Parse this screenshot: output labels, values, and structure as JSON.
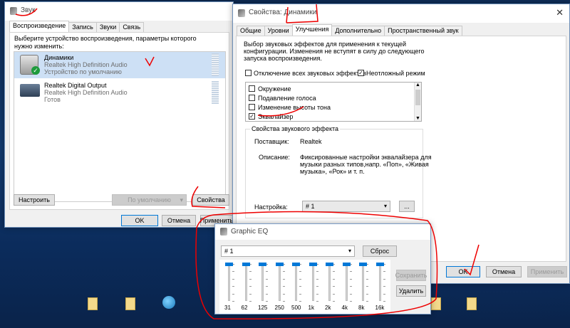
{
  "sound_window": {
    "title": "Звук",
    "tabs": [
      "Воспроизведение",
      "Запись",
      "Звуки",
      "Связь"
    ],
    "instruction": "Выберите устройство воспроизведения, параметры которого нужно изменить:",
    "devices": [
      {
        "name": "Динамики",
        "driver": "Realtek High Definition Audio",
        "status": "Устройство по умолчанию",
        "icon": "speaker-icon"
      },
      {
        "name": "Realtek Digital Output",
        "driver": "Realtek High Definition Audio",
        "status": "Готов",
        "icon": "digital-output-icon"
      }
    ],
    "configure_label": "Настроить",
    "default_label": "По умолчанию",
    "properties_label": "Свойства",
    "ok_label": "OK",
    "cancel_label": "Отмена",
    "apply_label": "Применить"
  },
  "props_window": {
    "title": "Свойства: Динамики",
    "tabs": [
      "Общие",
      "Уровни",
      "Улучшения",
      "Дополнительно",
      "Пространственный звук"
    ],
    "description": [
      "Выбор звуковых эффектов для применения к текущей",
      "конфигурации. Изменения не вступят в силу до следующего",
      "запуска воспроизведения."
    ],
    "disable_all_label": "Отключение всех звуковых эффектов",
    "immediate_label": "Неотложный режим",
    "effects": [
      {
        "label": "Окружение",
        "checked": false
      },
      {
        "label": "Подавление голоса",
        "checked": false
      },
      {
        "label": "Изменение высоты тона",
        "checked": false
      },
      {
        "label": "Эквалайзер",
        "checked": true
      }
    ],
    "group_title": "Свойства звукового эффекта",
    "provider_label": "Поставщик:",
    "provider_value": "Realtek",
    "desc_label": "Описание:",
    "desc_value": [
      "Фиксированные настройки эквалайзера для",
      "музыки разных типов,напр. «Поп», «Живая",
      "музыка», «Рок» и т. п."
    ],
    "setting_label": "Настройка:",
    "setting_value": "# 1",
    "more_label": "...",
    "ok_label": "OK",
    "cancel_label": "Отмена",
    "apply_label": "Применить"
  },
  "eq_window": {
    "title": "Graphic EQ",
    "preset": "# 1",
    "reset_label": "Сброс",
    "save_label": "Сохранить",
    "delete_label": "Удалить",
    "bands": [
      {
        "label": "31",
        "level": 1.0
      },
      {
        "label": "62",
        "level": 1.0
      },
      {
        "label": "125",
        "level": 1.0
      },
      {
        "label": "250",
        "level": 1.0
      },
      {
        "label": "500",
        "level": 1.0
      },
      {
        "label": "1k",
        "level": 1.0
      },
      {
        "label": "2k",
        "level": 1.0
      },
      {
        "label": "4k",
        "level": 1.0
      },
      {
        "label": "8k",
        "level": 1.0
      },
      {
        "label": "16k",
        "level": 1.0
      }
    ]
  }
}
